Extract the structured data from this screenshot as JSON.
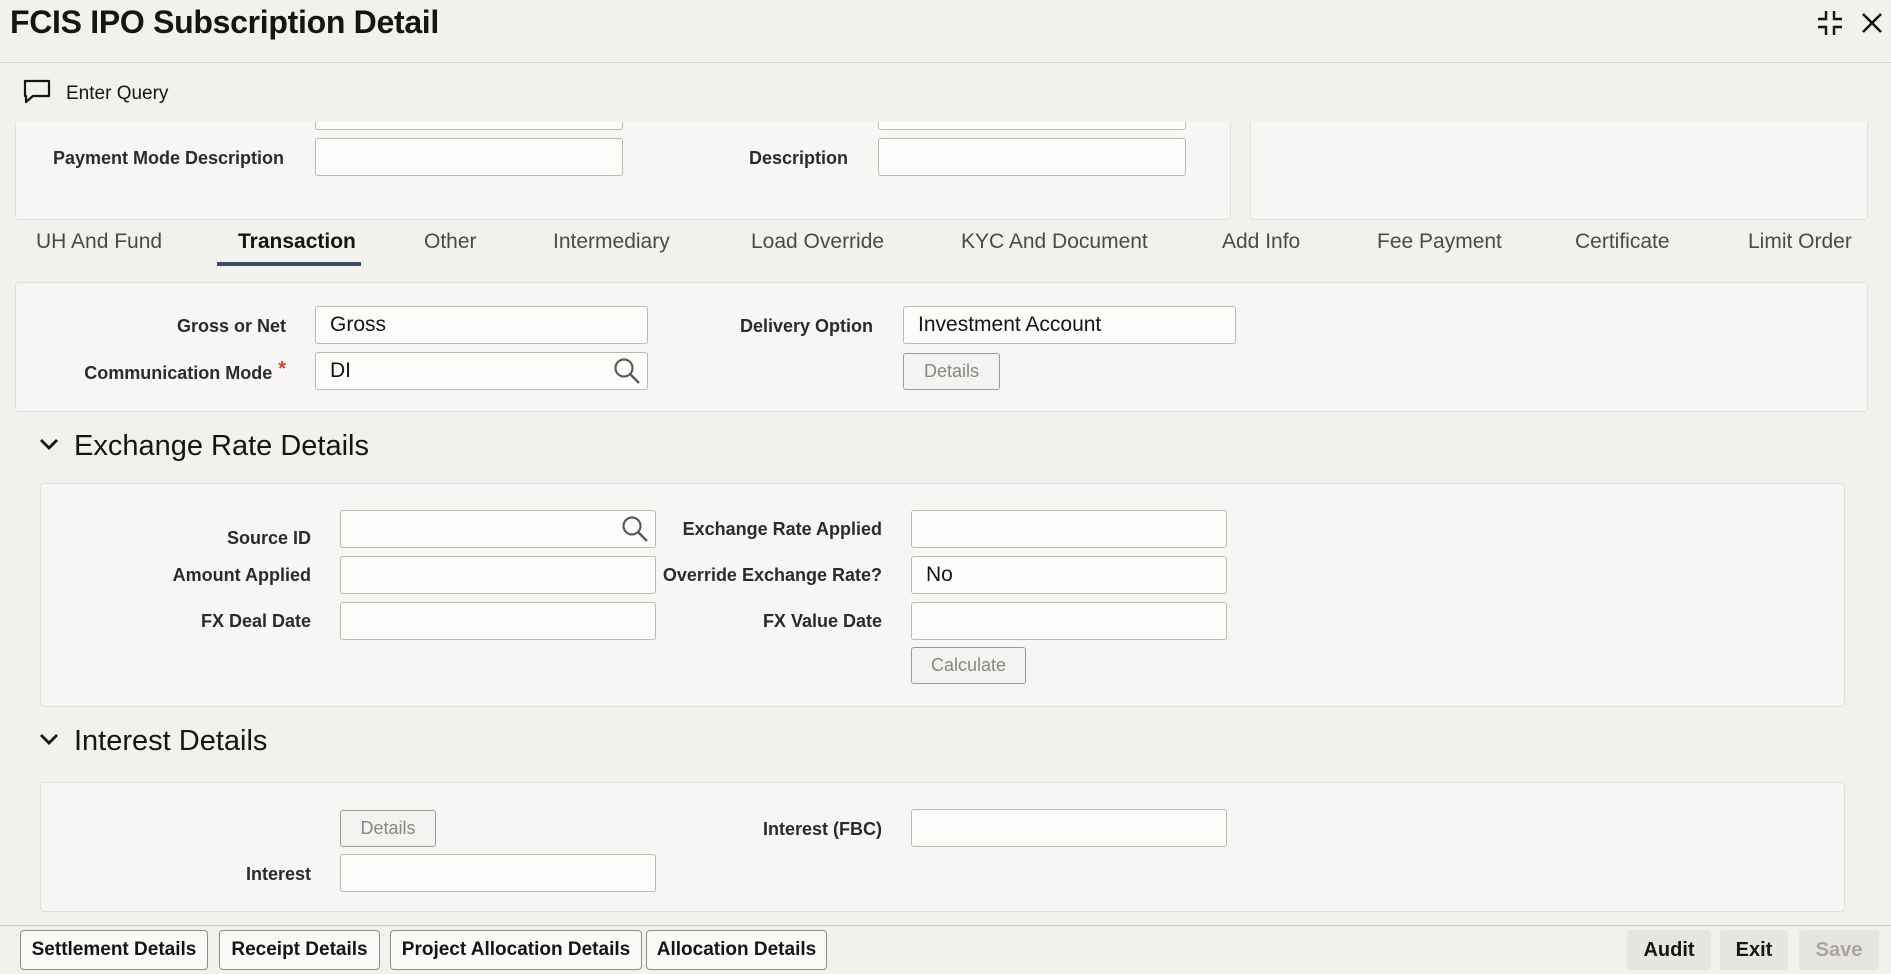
{
  "window": {
    "title": "FCIS IPO Subscription Detail"
  },
  "toolbar": {
    "enter_query_label": "Enter Query"
  },
  "top_section": {
    "payment_mode_description_label": "Payment Mode Description",
    "payment_mode_description_value": "",
    "description_label": "Description",
    "description_value": ""
  },
  "tabs": [
    {
      "label": "UH And Fund",
      "active": false
    },
    {
      "label": "Transaction",
      "active": true
    },
    {
      "label": "Other",
      "active": false
    },
    {
      "label": "Intermediary",
      "active": false
    },
    {
      "label": "Load Override",
      "active": false
    },
    {
      "label": "KYC And Document",
      "active": false
    },
    {
      "label": "Add Info",
      "active": false
    },
    {
      "label": "Fee Payment",
      "active": false
    },
    {
      "label": "Certificate",
      "active": false
    },
    {
      "label": "Limit Order",
      "active": false
    }
  ],
  "transaction": {
    "gross_or_net_label": "Gross or Net",
    "gross_or_net_value": "Gross",
    "communication_mode_label": "Communication Mode",
    "communication_mode_required": "*",
    "communication_mode_value": "DI",
    "delivery_option_label": "Delivery Option",
    "delivery_option_value": "Investment Account",
    "details_button": "Details"
  },
  "exchange_rate": {
    "heading": "Exchange Rate Details",
    "source_id_label": "Source ID",
    "source_id_value": "",
    "amount_applied_label": "Amount Applied",
    "amount_applied_value": "",
    "fx_deal_date_label": "FX Deal Date",
    "fx_deal_date_value": "",
    "exchange_rate_applied_label": "Exchange Rate Applied",
    "exchange_rate_applied_value": "",
    "override_exchange_rate_label": "Override Exchange Rate?",
    "override_exchange_rate_value": "No",
    "fx_value_date_label": "FX Value Date",
    "fx_value_date_value": "",
    "calculate_button": "Calculate"
  },
  "interest": {
    "heading": "Interest Details",
    "details_button": "Details",
    "interest_label": "Interest",
    "interest_value": "",
    "interest_fbc_label": "Interest (FBC)",
    "interest_fbc_value": ""
  },
  "footer": {
    "settlement_details": "Settlement Details",
    "receipt_details": "Receipt Details",
    "project_allocation_details": "Project Allocation Details",
    "allocation_details": "Allocation Details",
    "audit": "Audit",
    "exit": "Exit",
    "save": "Save"
  },
  "icons": {
    "enter_query": "chat-bubble-icon",
    "minimize": "collapse-icon",
    "close": "close-icon",
    "search": "search-icon",
    "section_toggle": "chevron-down-icon"
  },
  "colors": {
    "background": "#f3f1ed",
    "active_tab_underline": "#3b4d62",
    "required": "#c74634"
  }
}
